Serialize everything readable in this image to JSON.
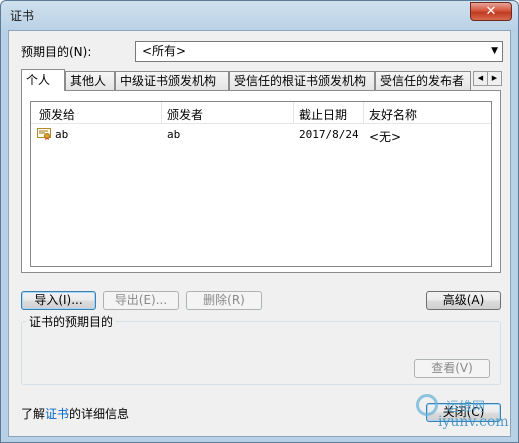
{
  "window": {
    "title": "证书",
    "close_glyph": "✕"
  },
  "purpose": {
    "label": "预期目的(N):",
    "selected": "<所有>"
  },
  "tabs": [
    {
      "label": "个人",
      "active": true
    },
    {
      "label": "其他人",
      "active": false
    },
    {
      "label": "中级证书颁发机构",
      "active": false
    },
    {
      "label": "受信任的根证书颁发机构",
      "active": false
    },
    {
      "label": "受信任的发布者",
      "active": false
    }
  ],
  "tab_scroll": {
    "left_glyph": "◀",
    "right_glyph": "▶"
  },
  "list": {
    "columns": [
      "颁发给",
      "颁发者",
      "截止日期",
      "友好名称"
    ],
    "rows": [
      {
        "issued_to": "ab",
        "issued_by": "ab",
        "expiration": "2017/8/24",
        "friendly_name": "<无>",
        "icon": "certificate-icon"
      }
    ]
  },
  "buttons": {
    "import": "导入(I)...",
    "export": "导出(E)...",
    "remove": "删除(R)",
    "advanced": "高级(A)",
    "view": "查看(V)",
    "close": "关闭(C)"
  },
  "group": {
    "title": "证书的预期目的"
  },
  "footer": {
    "prefix": "了解",
    "link": "证书",
    "suffix": "的详细信息"
  },
  "watermark": {
    "cn": "运维网",
    "en": "iyunv.com"
  },
  "colors": {
    "link": "#0066cc",
    "close_button": "#c03b22",
    "titlebar": "#b9d1e6"
  }
}
